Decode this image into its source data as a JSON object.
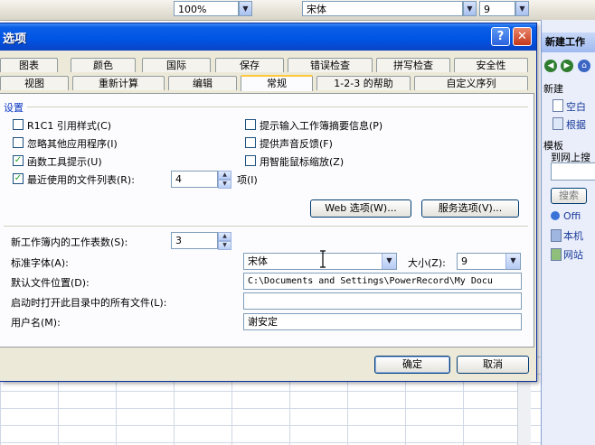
{
  "toolbar": {
    "zoom_value": "100%",
    "font_name": "宋体",
    "font_size": "9"
  },
  "task_pane": {
    "title": "新建工作",
    "section_new": "新建",
    "new_blank": "空白",
    "new_from_existing": "根据",
    "section_templates": "模板",
    "templates_online": "到网上搜",
    "search_button": "搜索",
    "office_online": "Offi",
    "my_computer": "本机",
    "website": "网站"
  },
  "dialog": {
    "title": "选项",
    "help_glyph": "?",
    "close_glyph": "✕",
    "tabs_row1": [
      "图表",
      "颜色",
      "国际",
      "保存",
      "错误检查",
      "拼写检查",
      "安全性"
    ],
    "tabs_row2": [
      "视图",
      "重新计算",
      "编辑",
      "常规",
      "1-2-3 的帮助",
      "自定义序列"
    ],
    "active_tab": "常规",
    "settings": {
      "section_title": "设置",
      "r1c1": {
        "label": "R1C1 引用样式(C)",
        "checked": false
      },
      "ignore_other_apps": {
        "label": "忽略其他应用程序(I)",
        "checked": false
      },
      "function_tooltips": {
        "label": "函数工具提示(U)",
        "checked": true
      },
      "recent_files": {
        "label": "最近使用的文件列表(R):",
        "checked": true,
        "value": "4",
        "unit": "项(I)"
      },
      "prompt_properties": {
        "label": "提示输入工作簿摘要信息(P)",
        "checked": false
      },
      "feedback_sound": {
        "label": "提供声音反馈(F)",
        "checked": false
      },
      "intellimouse_zoom": {
        "label": "用智能鼠标缩放(Z)",
        "checked": false
      },
      "web_options_button": "Web 选项(W)...",
      "service_options_button": "服务选项(V)..."
    },
    "sheets_in_new_workbook": {
      "label": "新工作簿内的工作表数(S):",
      "value": "3"
    },
    "standard_font": {
      "label": "标准字体(A):",
      "value": "宋体",
      "size_label": "大小(Z):",
      "size_value": "9"
    },
    "default_file_location": {
      "label": "默认文件位置(D):",
      "value": "C:\\Documents and Settings\\PowerRecord\\My Docu"
    },
    "startup_folder": {
      "label": "启动时打开此目录中的所有文件(L):",
      "value": ""
    },
    "user_name": {
      "label": "用户名(M):",
      "value": "谢安定"
    },
    "ok_button": "确定",
    "cancel_button": "取消"
  }
}
